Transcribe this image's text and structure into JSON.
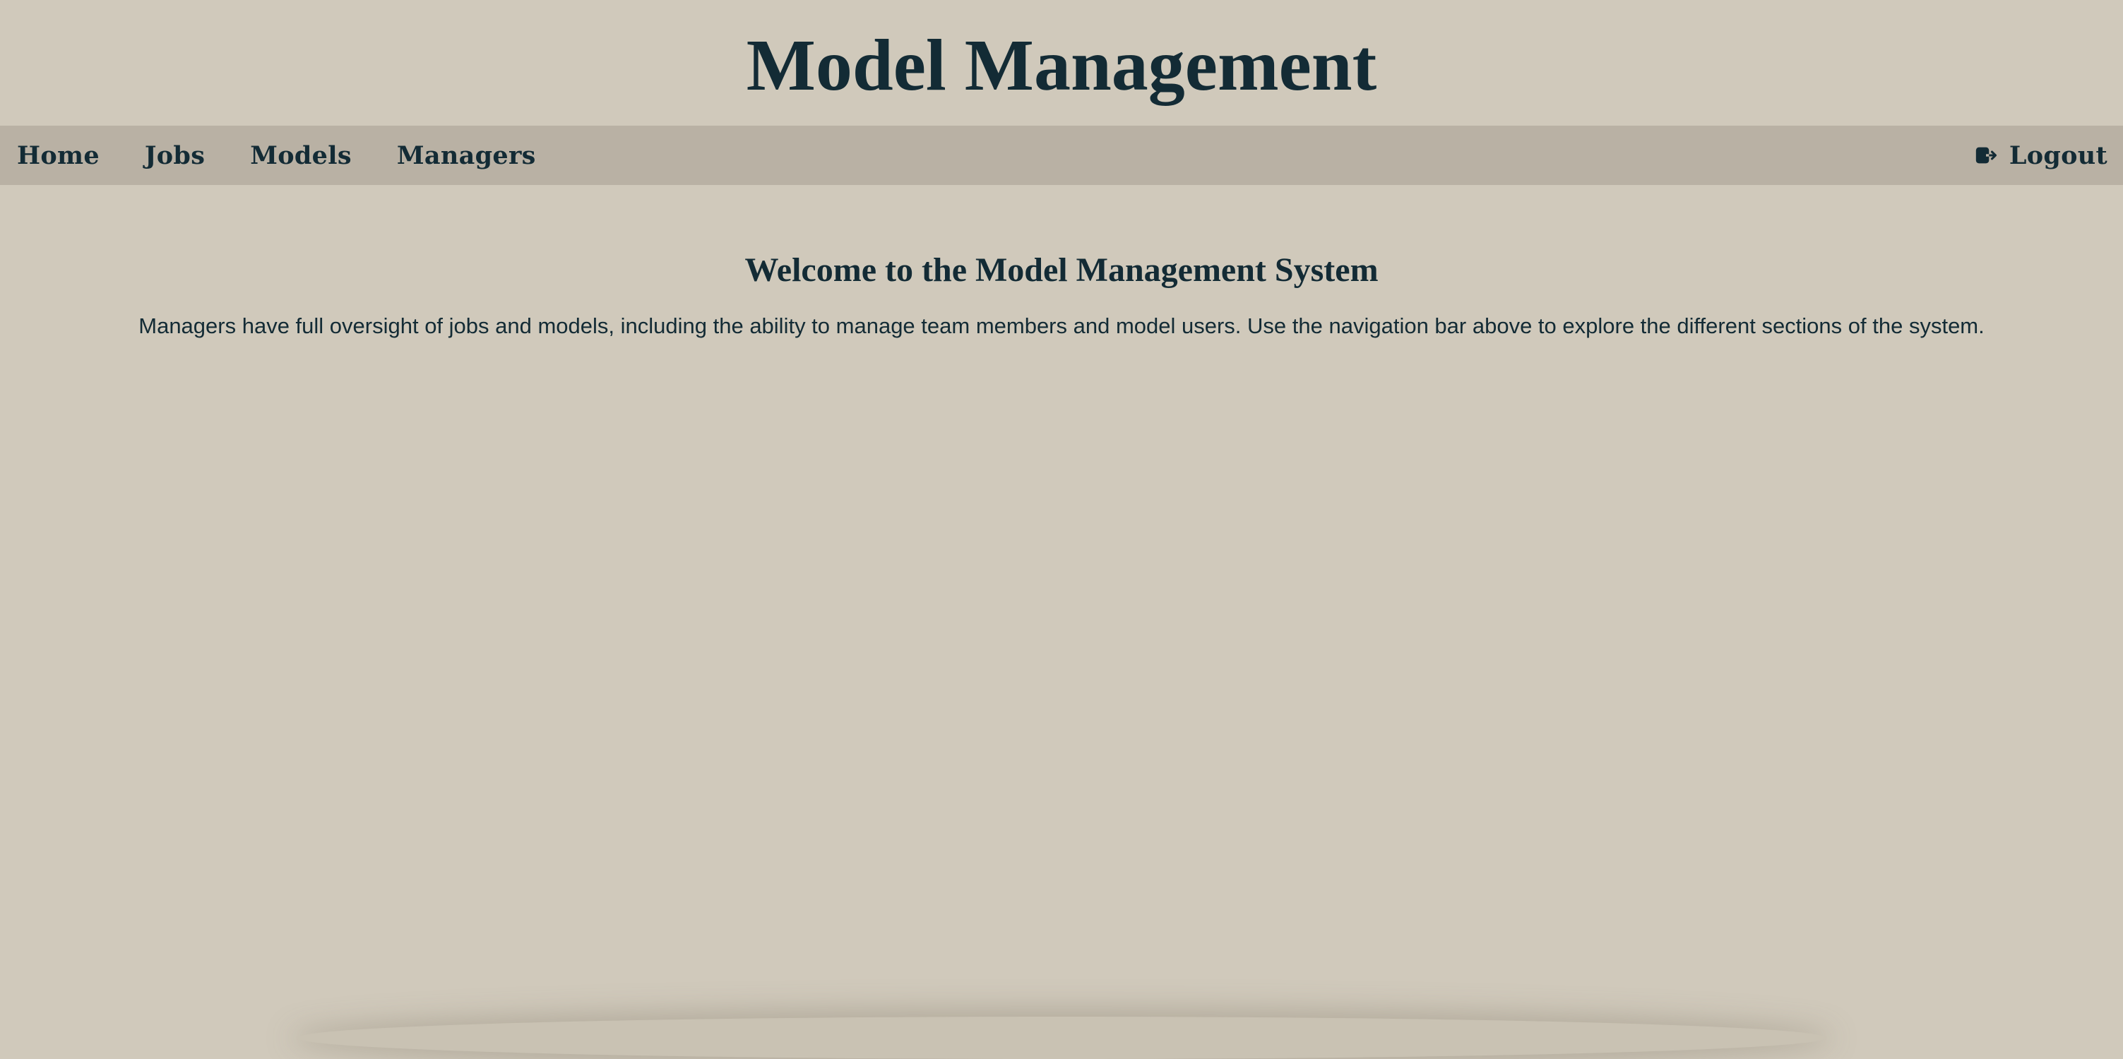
{
  "header": {
    "title": "Model Management"
  },
  "nav": {
    "items": [
      {
        "label": "Home"
      },
      {
        "label": "Jobs"
      },
      {
        "label": "Models"
      },
      {
        "label": "Managers"
      }
    ],
    "logout": {
      "label": "Logout",
      "icon": "logout-icon"
    }
  },
  "main": {
    "heading": "Welcome to the Model Management System",
    "description": "Managers have full oversight of jobs and models, including the ability to manage team members and model users. Use the navigation bar above to explore the different sections of the system."
  },
  "colors": {
    "background": "#d0c9bb",
    "navbar": "#b9b1a4",
    "text": "#132b35"
  }
}
